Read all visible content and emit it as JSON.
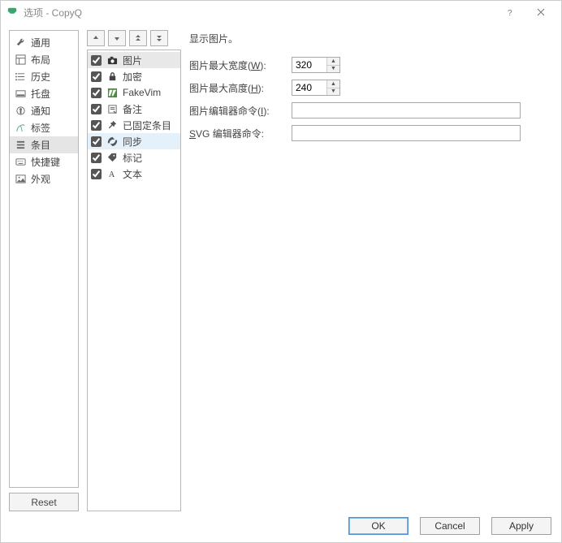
{
  "titlebar": {
    "title": "选项 - CopyQ"
  },
  "sidebar": {
    "items": [
      {
        "label": "通用",
        "icon": "wrench-icon"
      },
      {
        "label": "布局",
        "icon": "layout-icon"
      },
      {
        "label": "历史",
        "icon": "list-icon"
      },
      {
        "label": "托盘",
        "icon": "tray-icon"
      },
      {
        "label": "通知",
        "icon": "bell-icon"
      },
      {
        "label": "标签",
        "icon": "tag-icon"
      },
      {
        "label": "条目",
        "icon": "hamburger-icon",
        "selected": true
      },
      {
        "label": "快捷键",
        "icon": "keyboard-icon"
      },
      {
        "label": "外观",
        "icon": "image-icon"
      }
    ],
    "reset_label": "Reset"
  },
  "checklist": {
    "items": [
      {
        "label": "图片",
        "icon": "camera-icon",
        "checked": true,
        "selected": true
      },
      {
        "label": "加密",
        "icon": "lock-icon",
        "checked": true
      },
      {
        "label": "FakeVim",
        "icon": "vim-icon",
        "checked": true
      },
      {
        "label": "备注",
        "icon": "note-icon",
        "checked": true
      },
      {
        "label": "已固定条目",
        "icon": "pin-icon",
        "checked": true
      },
      {
        "label": "同步",
        "icon": "sync-icon",
        "checked": true,
        "hover": true
      },
      {
        "label": "标记",
        "icon": "pricetag-icon",
        "checked": true
      },
      {
        "label": "文本",
        "icon": "text-a-icon",
        "checked": true
      }
    ]
  },
  "main": {
    "heading": "显示图片。",
    "max_width_label_pre": "图片最大宽度(",
    "max_width_access": "W",
    "max_width_label_post": "):",
    "max_width_value": "320",
    "max_height_label_pre": "图片最大高度(",
    "max_height_access": "H",
    "max_height_label_post": "):",
    "max_height_value": "240",
    "image_editor_label_pre": "图片编辑器命令(",
    "image_editor_access": "I",
    "image_editor_label_post": "):",
    "image_editor_value": "",
    "svg_editor_access": "S",
    "svg_editor_label_post": "VG 编辑器命令:",
    "svg_editor_value": ""
  },
  "footer": {
    "ok_label": "OK",
    "cancel_label": "Cancel",
    "apply_label": "Apply"
  }
}
